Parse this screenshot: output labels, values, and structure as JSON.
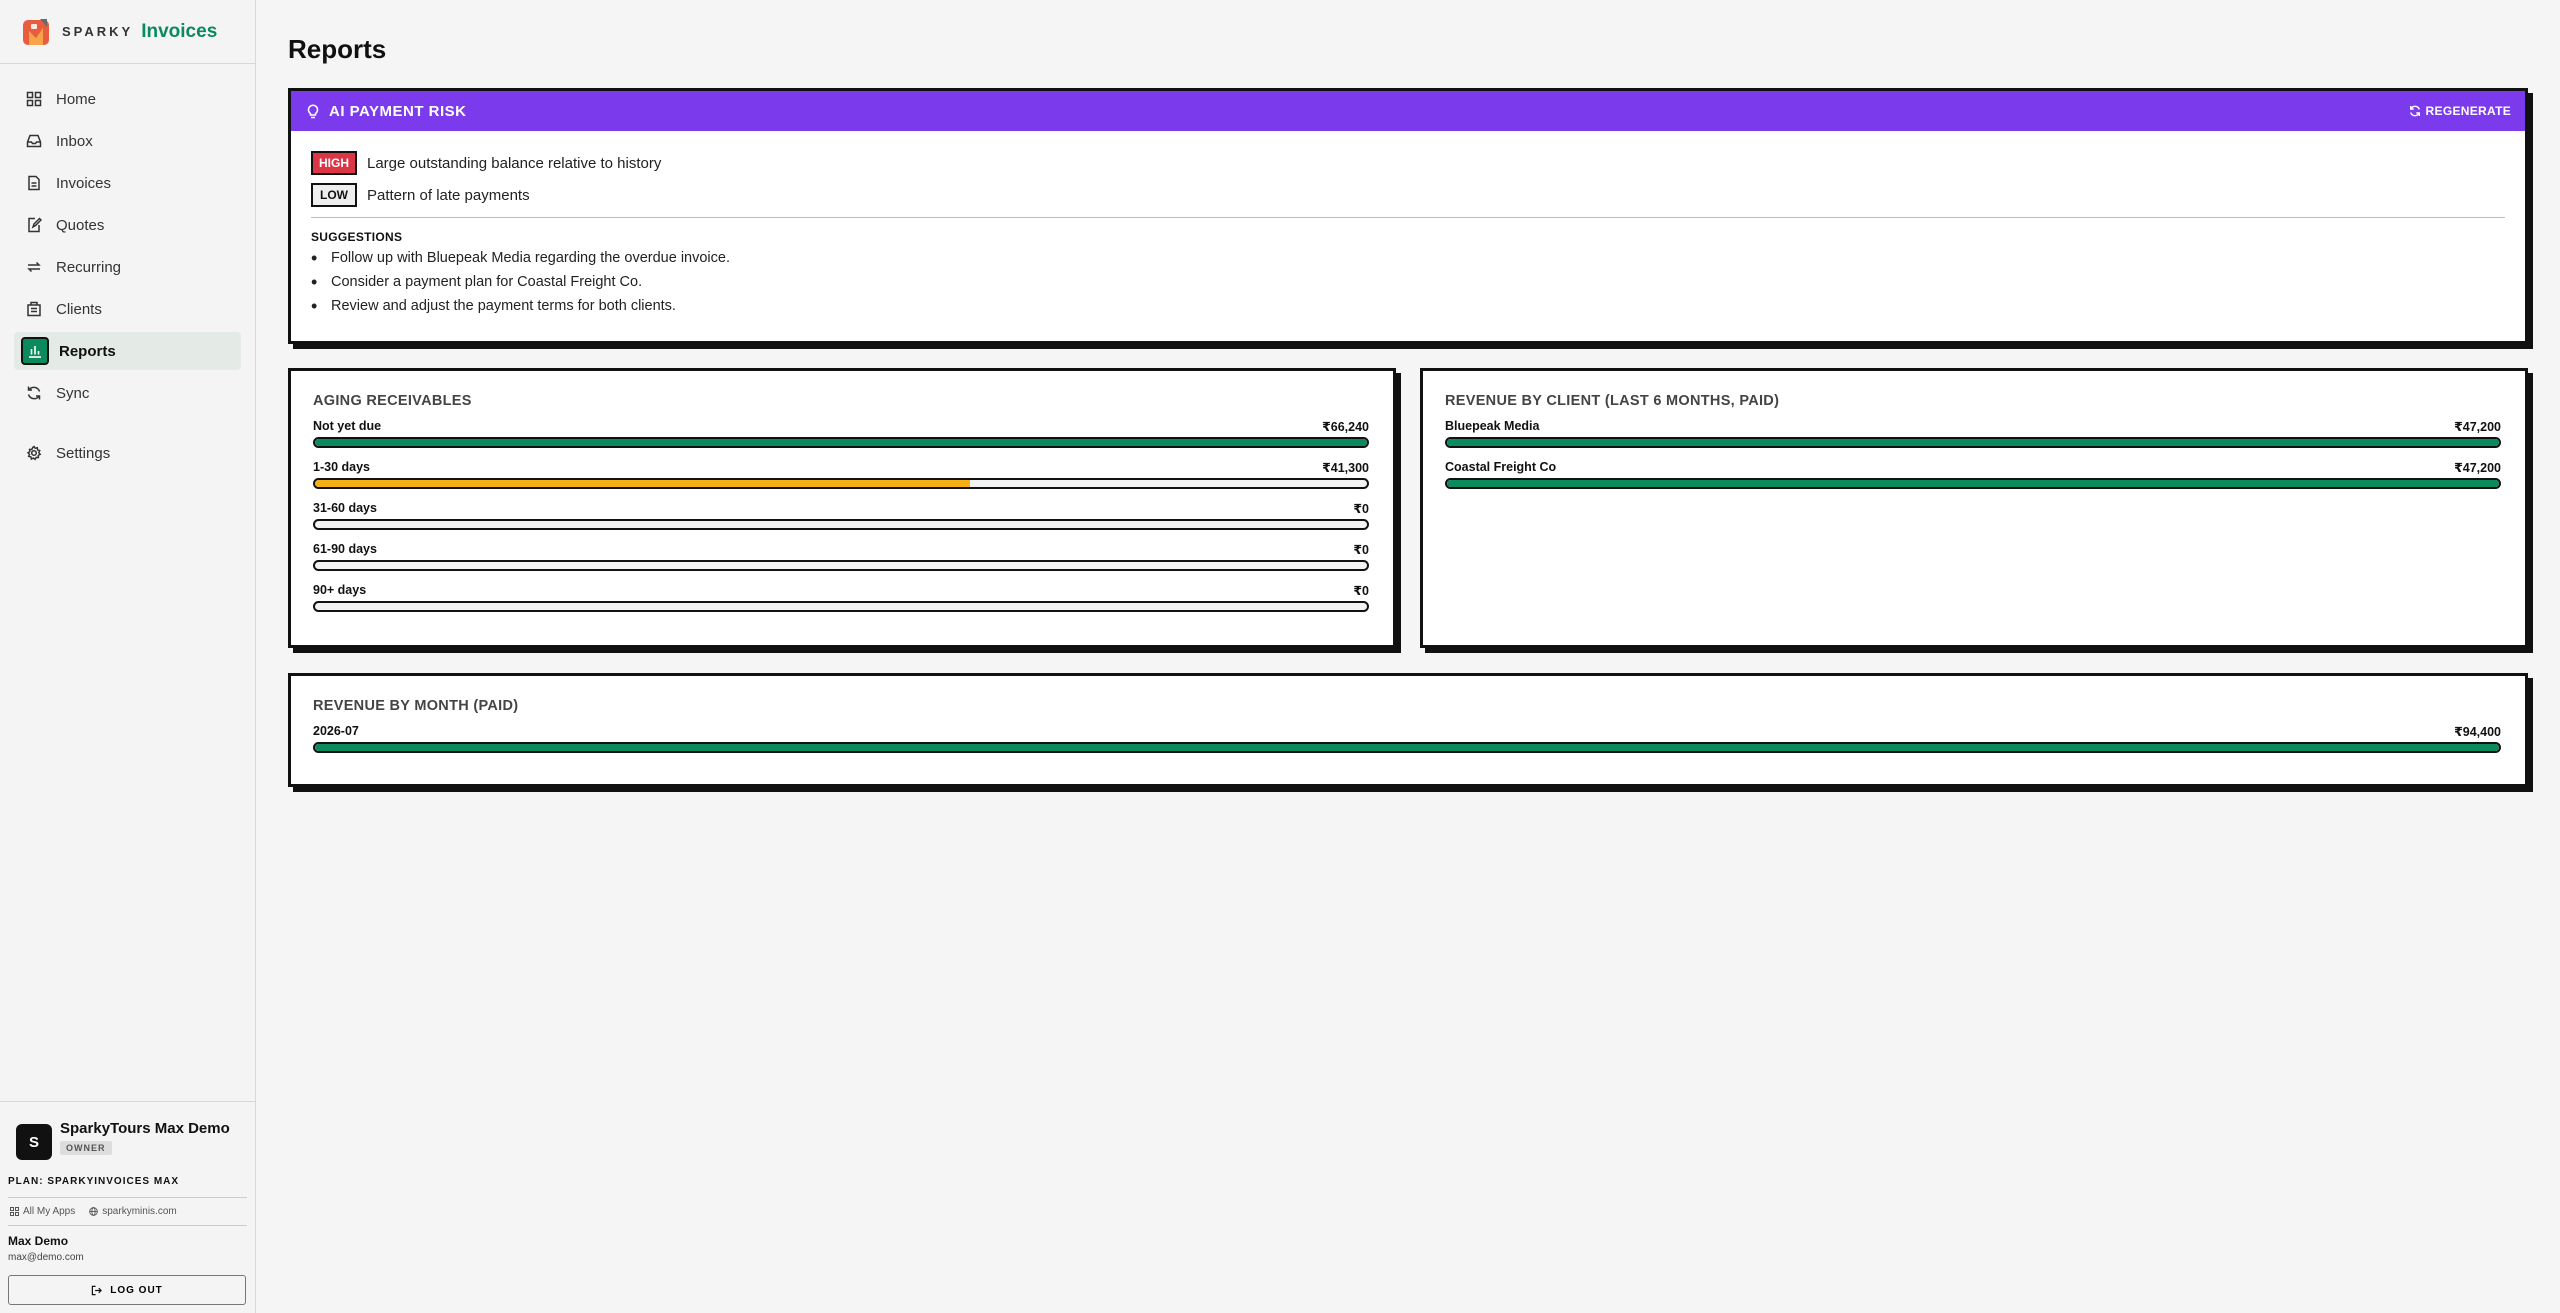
{
  "brand": {
    "prefix": "SPARKY",
    "name": "Invoices"
  },
  "nav": [
    {
      "label": "Home",
      "icon": "home-icon"
    },
    {
      "label": "Inbox",
      "icon": "inbox-icon"
    },
    {
      "label": "Invoices",
      "icon": "document-icon"
    },
    {
      "label": "Quotes",
      "icon": "quote-icon"
    },
    {
      "label": "Recurring",
      "icon": "recurring-icon"
    },
    {
      "label": "Clients",
      "icon": "clients-icon"
    },
    {
      "label": "Reports",
      "icon": "chart-icon",
      "active": true
    },
    {
      "label": "Sync",
      "icon": "sync-icon"
    },
    {
      "label": "Settings",
      "icon": "gear-icon"
    }
  ],
  "org": {
    "initial": "S",
    "name": "SparkyTours Max Demo",
    "role": "OWNER"
  },
  "plan": "PLAN: SPARKYINVOICES MAX",
  "links": {
    "apps": "All My Apps",
    "site": "sparkyminis.com"
  },
  "user": {
    "name": "Max Demo",
    "email": "max@demo.com"
  },
  "logout_label": "LOG OUT",
  "page": {
    "title": "Reports"
  },
  "risk": {
    "title": "AI PAYMENT RISK",
    "regenerate": "REGENERATE",
    "items": [
      {
        "level": "HIGH",
        "text": "Large outstanding balance relative to history"
      },
      {
        "level": "LOW",
        "text": "Pattern of late payments"
      }
    ],
    "suggestions_title": "SUGGESTIONS",
    "suggestions": [
      "Follow up with Bluepeak Media regarding the overdue invoice.",
      "Consider a payment plan for Coastal Freight Co.",
      "Review and adjust the payment terms for both clients."
    ]
  },
  "aging": {
    "title": "AGING RECEIVABLES",
    "rows": [
      {
        "label": "Not yet due",
        "value": "₹66,240",
        "fraction": 1.0,
        "color": "#0b8a5d"
      },
      {
        "label": "1-30 days",
        "value": "₹41,300",
        "fraction": 0.623,
        "color": "#f5b015"
      },
      {
        "label": "31-60 days",
        "value": "₹0",
        "fraction": 0,
        "color": "#0b8a5d"
      },
      {
        "label": "61-90 days",
        "value": "₹0",
        "fraction": 0,
        "color": "#0b8a5d"
      },
      {
        "label": "90+ days",
        "value": "₹0",
        "fraction": 0,
        "color": "#0b8a5d"
      }
    ]
  },
  "by_client": {
    "title": "REVENUE BY CLIENT (LAST 6 MONTHS, PAID)",
    "rows": [
      {
        "label": "Bluepeak Media",
        "value": "₹47,200",
        "fraction": 1.0,
        "color": "#0b8a5d"
      },
      {
        "label": "Coastal Freight Co",
        "value": "₹47,200",
        "fraction": 1.0,
        "color": "#0b8a5d"
      }
    ]
  },
  "by_month": {
    "title": "REVENUE BY MONTH (PAID)",
    "rows": [
      {
        "label": "2026-07",
        "value": "₹94,400",
        "fraction": 1.0,
        "color": "#0b8a5d"
      }
    ]
  }
}
